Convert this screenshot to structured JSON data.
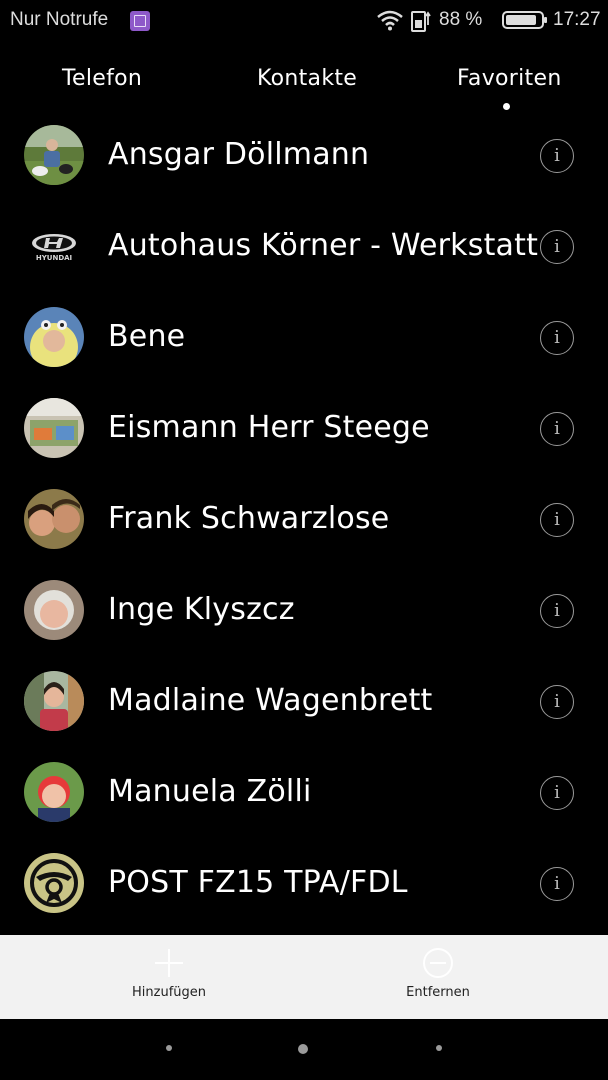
{
  "status_bar": {
    "carrier": "Nur Notrufe",
    "battery_percent": "88 %",
    "battery_level": 0.88,
    "time": "17:27"
  },
  "tabs": [
    {
      "label": "Telefon"
    },
    {
      "label": "Kontakte"
    },
    {
      "label": "Favoriten",
      "active": true
    }
  ],
  "contacts": [
    {
      "name": "Ansgar Döllmann",
      "avatar": "photo-person-outdoors"
    },
    {
      "name": "Autohaus Körner - Werkstatt",
      "avatar": "hyundai-logo",
      "logo_text": "HYUNDAI"
    },
    {
      "name": "Bene",
      "avatar": "photo-child-costume"
    },
    {
      "name": "Eismann Herr Steege",
      "avatar": "photo-eismann-truck"
    },
    {
      "name": "Frank Schwarzlose",
      "avatar": "photo-couple"
    },
    {
      "name": "Inge Klyszcz",
      "avatar": "photo-woman-grey-hair"
    },
    {
      "name": "Madlaine Wagenbrett",
      "avatar": "photo-girl"
    },
    {
      "name": "Manuela Zölli",
      "avatar": "photo-woman-red-hair"
    },
    {
      "name": "POST FZ15 TPA/FDL",
      "avatar": "post-horn-logo"
    }
  ],
  "actions": {
    "add_label": "Hinzufügen",
    "remove_label": "Entfernen"
  },
  "colors": {
    "background": "#000000",
    "action_bar": "#f2f2f2",
    "carrier_badge": "#8e59c9"
  }
}
